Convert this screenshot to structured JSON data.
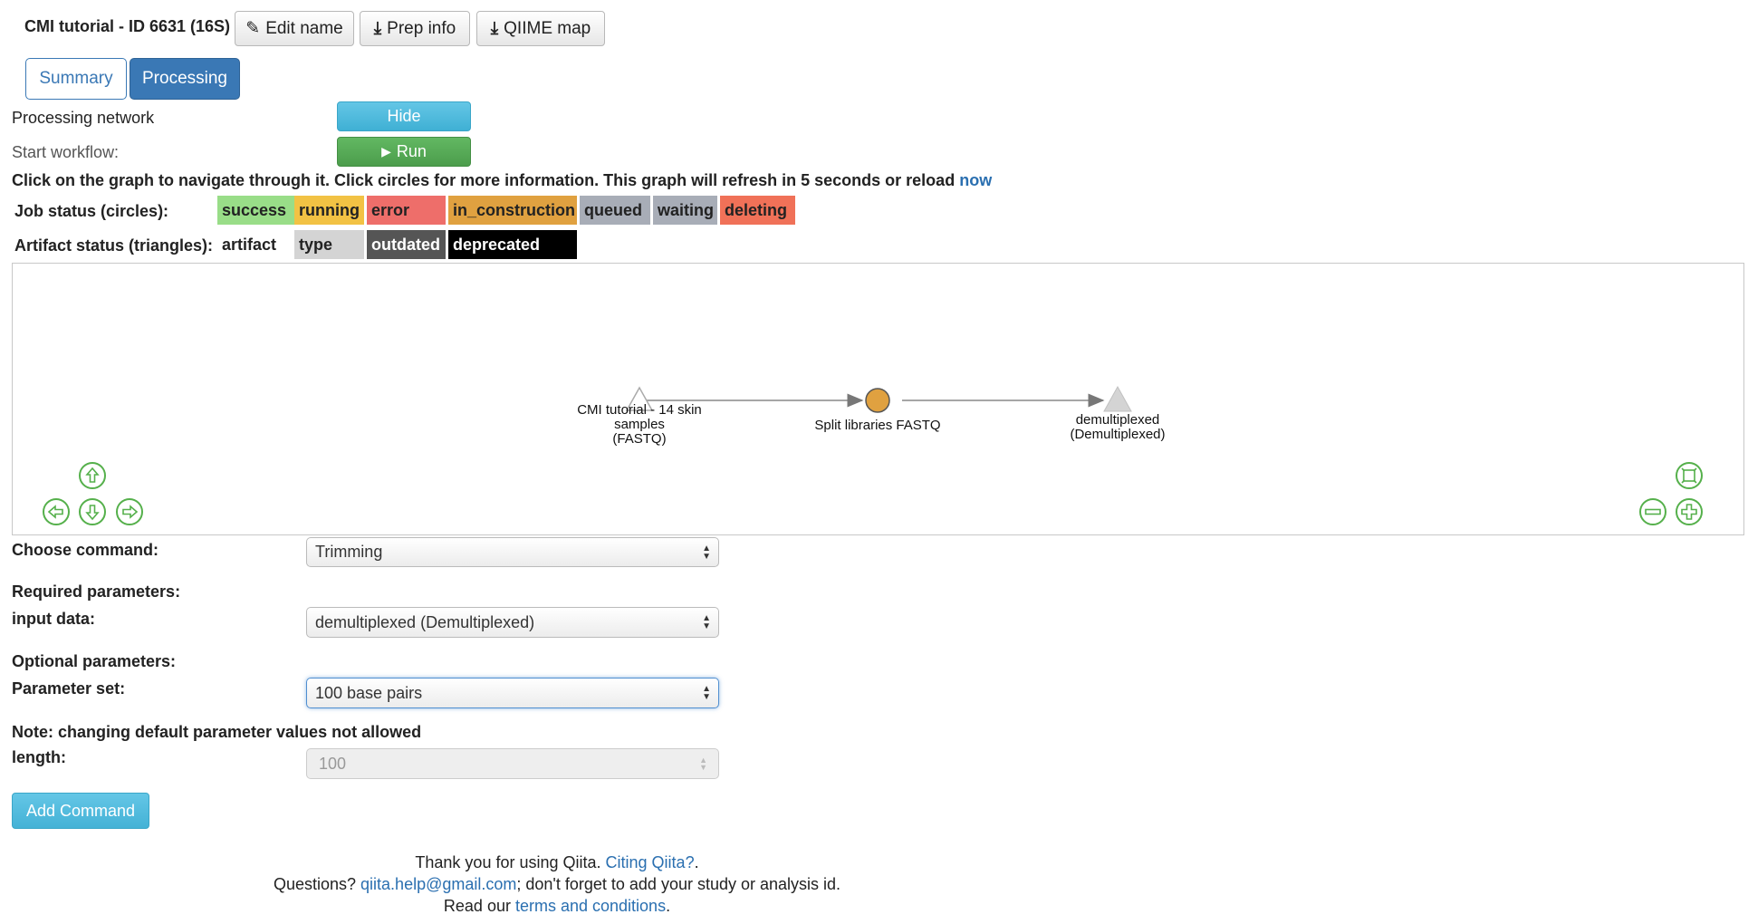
{
  "header": {
    "title": "CMI tutorial - ID 6631 (16S)",
    "edit_name": "Edit name",
    "prep_info": "Prep info",
    "qiime_map": "QIIME map"
  },
  "tabs": {
    "summary": "Summary",
    "processing": "Processing"
  },
  "processing": {
    "network_label": "Processing network",
    "hide_button": "Hide",
    "start_workflow_label": "Start workflow:",
    "run_button": "Run",
    "instructions": "Click on the graph to navigate through it. Click circles for more information. This graph will refresh in 5 seconds or reload",
    "reload_link": "now"
  },
  "legend": {
    "job_status_label": "Job status (circles):",
    "job_statuses": [
      {
        "label": "success",
        "color": "#99dd88"
      },
      {
        "label": "running",
        "color": "#f2c244"
      },
      {
        "label": "error",
        "color": "#ee6e6a"
      },
      {
        "label": "in_construction",
        "color": "#e0a140"
      },
      {
        "label": "queued",
        "color": "#a8adb7"
      },
      {
        "label": "waiting",
        "color": "#a8adb7"
      },
      {
        "label": "deleting",
        "color": "#f07158"
      }
    ],
    "artifact_status_label": "Artifact status (triangles):",
    "artifact_statuses": [
      {
        "label": "artifact",
        "color": "#ffffff",
        "text_color": "#222"
      },
      {
        "label": "type",
        "color": "#d4d4d4",
        "text_color": "#222"
      },
      {
        "label": "outdated",
        "color": "#555555",
        "text_color": "#ffffff"
      },
      {
        "label": "deprecated",
        "color": "#000000",
        "text_color": "#ffffff"
      }
    ]
  },
  "graph": {
    "nodes": [
      {
        "label_lines": [
          "CMI tutorial - 14 skin",
          "samples",
          "(FASTQ)"
        ],
        "shape": "triangle",
        "color": "#ffffff"
      },
      {
        "label_lines": [
          "Split libraries FASTQ"
        ],
        "shape": "circle",
        "color": "#e0a140"
      },
      {
        "label_lines": [
          "demultiplexed",
          "(Demultiplexed)"
        ],
        "shape": "triangle",
        "color": "#d4d4d4"
      }
    ],
    "nav_icons": [
      "arrow-up-icon",
      "arrow-left-icon",
      "arrow-down-icon",
      "arrow-right-icon",
      "fit-screen-icon",
      "zoom-out-icon",
      "zoom-in-icon"
    ]
  },
  "form": {
    "choose_command_label": "Choose command:",
    "command_value": "Trimming",
    "required_params_label": "Required parameters:",
    "input_data_label": "input data:",
    "input_data_value": "demultiplexed (Demultiplexed)",
    "optional_params_label": "Optional parameters:",
    "parameter_set_label": "Parameter set:",
    "parameter_set_value": "100 base pairs",
    "note": "Note: changing default parameter values not allowed",
    "length_label": "length:",
    "length_value": "100",
    "add_command_button": "Add Command"
  },
  "footer": {
    "thanks": "Thank you for using Qiita.",
    "citing_link": "Citing Qiita?",
    "questions": "Questions?",
    "email_link": "qiita.help@gmail.com",
    "questions_rest": "; don't forget to add your study or analysis id.",
    "read_our": "Read our",
    "terms_link": "terms and conditions"
  },
  "colors": {
    "accent": "#3a78b5",
    "hide_button": "#5bc0de",
    "run_button": "#5cb85c",
    "nav_icon": "#55b04b"
  }
}
